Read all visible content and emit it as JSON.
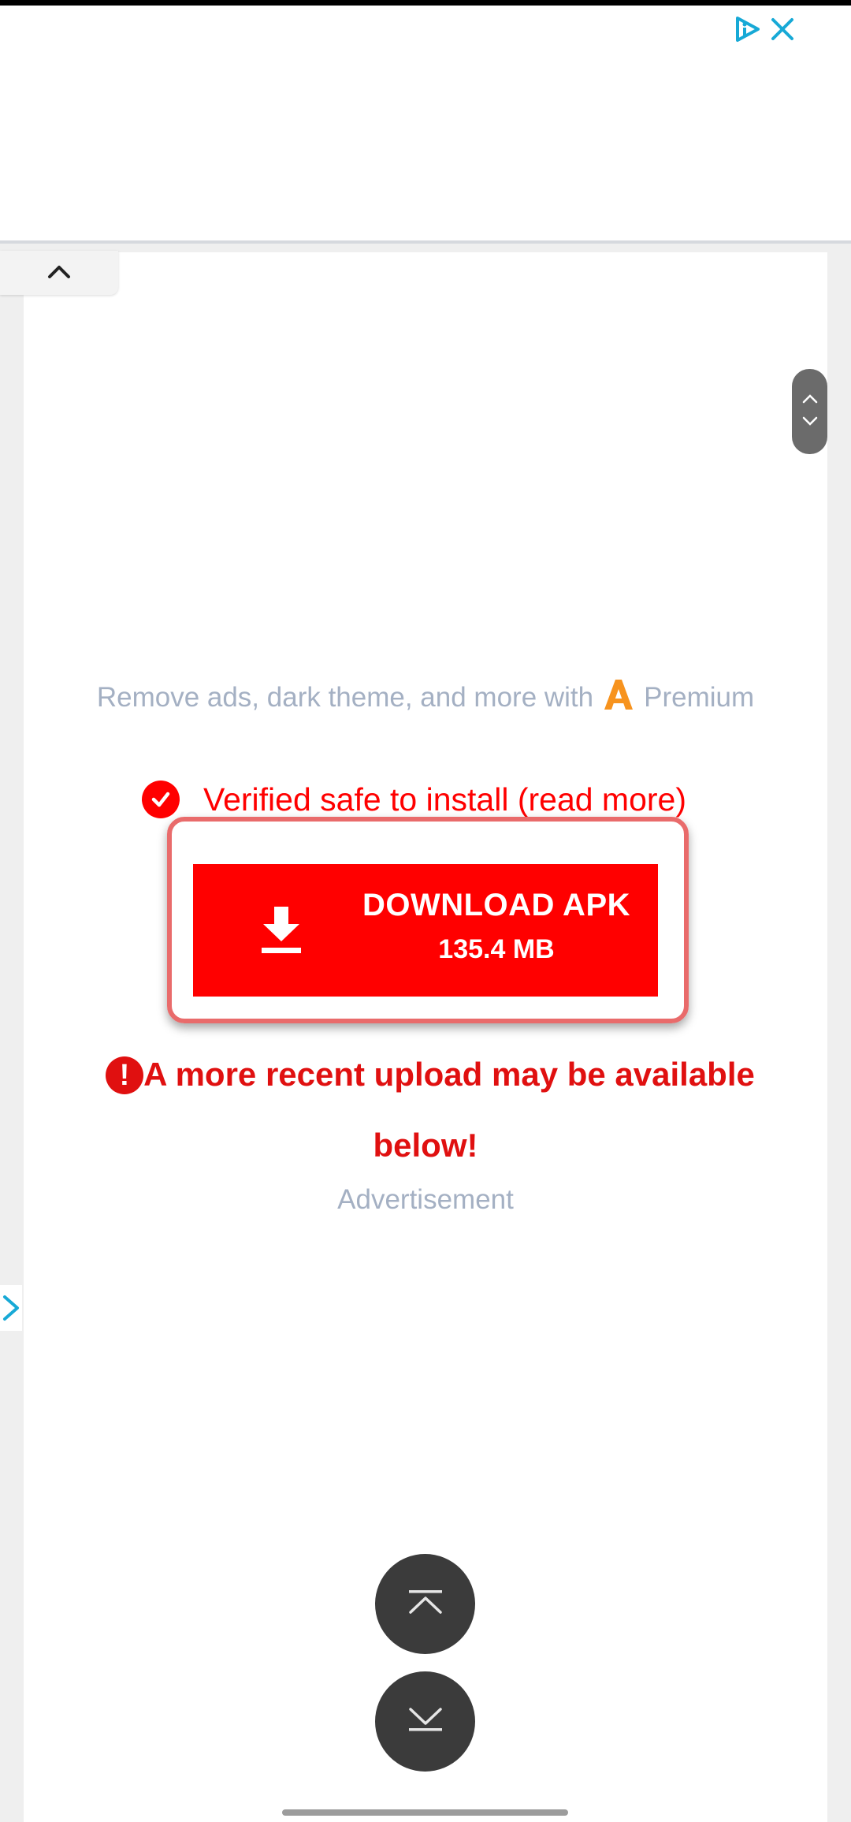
{
  "premium_banner": {
    "text_before": "Remove ads, dark theme, and more with",
    "text_after": "Premium"
  },
  "verified": {
    "text": "Verified safe to install (read more)"
  },
  "download": {
    "label": "DOWNLOAD APK",
    "size": "135.4 MB"
  },
  "warning": {
    "line1": "A more recent upload may be available",
    "line2": "below!"
  },
  "advertisement_label": "Advertisement",
  "colors": {
    "accent_red": "#ff0000",
    "warning_red": "#e01010",
    "muted_text": "#a4b0c3",
    "fab_dark": "#3b3b3b"
  },
  "icons": {
    "ad_choices": "ad-choices-icon",
    "ad_close": "close-icon",
    "collapse": "chevron-up-icon",
    "download": "download-icon",
    "scroll_top": "scroll-to-top-icon",
    "scroll_bottom": "scroll-to-bottom-icon"
  }
}
